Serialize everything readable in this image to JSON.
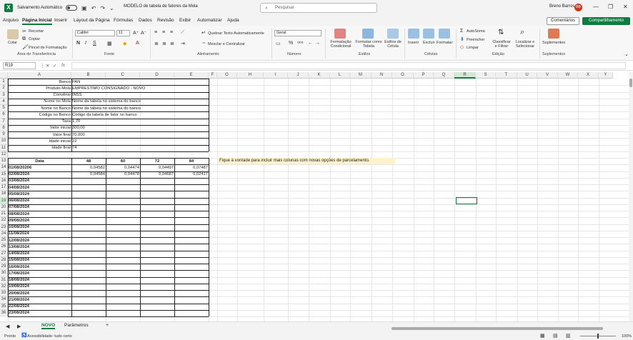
{
  "titlebar": {
    "autosave_label": "Salvamento Automático",
    "doc_title": "MODELO de tabela de fatores da Mola",
    "search_placeholder": "Pesquisar",
    "user_name": "Breno Barros",
    "user_initials": "BB"
  },
  "menu": {
    "items": [
      "Arquivo",
      "Página Inicial",
      "Inserir",
      "Layout da Página",
      "Fórmulas",
      "Dados",
      "Revisão",
      "Exibir",
      "Automatizar",
      "Ajuda"
    ],
    "comments_label": "Comentários",
    "share_label": "Compartilhamento"
  },
  "ribbon": {
    "paste": "Colar",
    "cut": "Recortar",
    "copy": "Copiar",
    "format_painter": "Pincel de Formatação",
    "group_clipboard": "Área de Transferência",
    "font_name": "Calibri",
    "font_size": "11",
    "group_font": "Fonte",
    "wrap_text": "Quebrar Texto Automaticamente",
    "merge_center": "Mesclar e Centralizar",
    "group_alignment": "Alinhamento",
    "number_format": "Geral",
    "group_number": "Número",
    "cond_format": "Formatação Condicional",
    "format_table": "Formatar como Tabela",
    "cell_styles": "Estilos de Célula",
    "group_styles": "Estilos",
    "insert": "Inserir",
    "delete": "Excluir",
    "format": "Formatar",
    "group_cells": "Células",
    "autosum": "AutoSoma",
    "fill": "Preencher",
    "clear": "Limpar",
    "sort_filter": "Classificar e Filtrar",
    "find_select": "Localizar e Selecionar",
    "group_editing": "Edição",
    "addins": "Suplementos",
    "group_addins": "Suplementos"
  },
  "formula_bar": {
    "name_box": "R19",
    "fx": "fx",
    "content": ""
  },
  "columns": [
    "A",
    "B",
    "C",
    "D",
    "E",
    "F",
    "G",
    "H",
    "I",
    "J",
    "K",
    "L",
    "M",
    "N",
    "O",
    "P",
    "Q",
    "R",
    "S",
    "T",
    "U",
    "V",
    "W",
    "X",
    "Y"
  ],
  "rows": [
    "1",
    "2",
    "3",
    "4",
    "5",
    "6",
    "7",
    "8",
    "9",
    "10",
    "11",
    "12",
    "13",
    "14",
    "15",
    "16",
    "17",
    "18",
    "19",
    "20",
    "21",
    "22",
    "23",
    "24",
    "25",
    "26",
    "27",
    "28",
    "29",
    "30",
    "31",
    "32",
    "33",
    "34",
    "35",
    "36"
  ],
  "info_table": [
    {
      "label": "Banco",
      "value": "PAN"
    },
    {
      "label": "Produto-Mola",
      "value": "EMPRESTIMO CONSIGNADO - NOVO"
    },
    {
      "label": "Convênio",
      "value": "INSS"
    },
    {
      "label": "Nome no Mola",
      "value": "Nome da tabela no sistema do banco"
    },
    {
      "label": "Nome no Banco",
      "value": "Nome da tabela no sistema do banco"
    },
    {
      "label": "Código no Banco",
      "value": "Código da tabela de fator no banco"
    },
    {
      "label": "Taxa",
      "value": "1,70"
    },
    {
      "label": "Valor inicial",
      "value": "300,00"
    },
    {
      "label": "Valor final",
      "value": "70.000"
    },
    {
      "label": "Idade inicial",
      "value": "22"
    },
    {
      "label": "Idade final",
      "value": "74"
    }
  ],
  "factor_table": {
    "headers": [
      "Data",
      "48",
      "60",
      "72",
      "84"
    ],
    "rows": [
      [
        "01/08/20206",
        "0,04582",
        "0,04474",
        "0,04497",
        "0,07487"
      ],
      [
        "02/08/2024",
        "0,04584",
        "0,04478",
        "0,04687",
        "0,02417"
      ],
      [
        "03/08/2024",
        "",
        "",
        "",
        ""
      ],
      [
        "04/08/2024",
        "",
        "",
        "",
        ""
      ],
      [
        "05/08/2024",
        "",
        "",
        "",
        ""
      ],
      [
        "06/08/2024",
        "",
        "",
        "",
        ""
      ],
      [
        "07/08/2024",
        "",
        "",
        "",
        ""
      ],
      [
        "08/08/2024",
        "",
        "",
        "",
        ""
      ],
      [
        "09/08/2024",
        "",
        "",
        "",
        ""
      ],
      [
        "10/08/2024",
        "",
        "",
        "",
        ""
      ],
      [
        "11/08/2024",
        "",
        "",
        "",
        ""
      ],
      [
        "12/08/2024",
        "",
        "",
        "",
        ""
      ],
      [
        "13/08/2024",
        "",
        "",
        "",
        ""
      ],
      [
        "14/08/2024",
        "",
        "",
        "",
        ""
      ],
      [
        "15/08/2024",
        "",
        "",
        "",
        ""
      ],
      [
        "16/08/2024",
        "",
        "",
        "",
        ""
      ],
      [
        "17/08/2024",
        "",
        "",
        "",
        ""
      ],
      [
        "18/08/2024",
        "",
        "",
        "",
        ""
      ],
      [
        "19/08/2024",
        "",
        "",
        "",
        ""
      ],
      [
        "20/08/2024",
        "",
        "",
        "",
        ""
      ],
      [
        "21/08/2024",
        "",
        "",
        "",
        ""
      ],
      [
        "22/08/2024",
        "",
        "",
        "",
        ""
      ],
      [
        "23/08/2024",
        "",
        "",
        "",
        ""
      ]
    ]
  },
  "note": "Fique à vontade para incluir mais colunas com novas opções de parcelamento.",
  "sheets": {
    "active": "NOVO",
    "other": "Parâmetros"
  },
  "status": {
    "ready": "Pronto",
    "accessibility": "Acessibilidade: tudo certo",
    "zoom": "100%"
  }
}
